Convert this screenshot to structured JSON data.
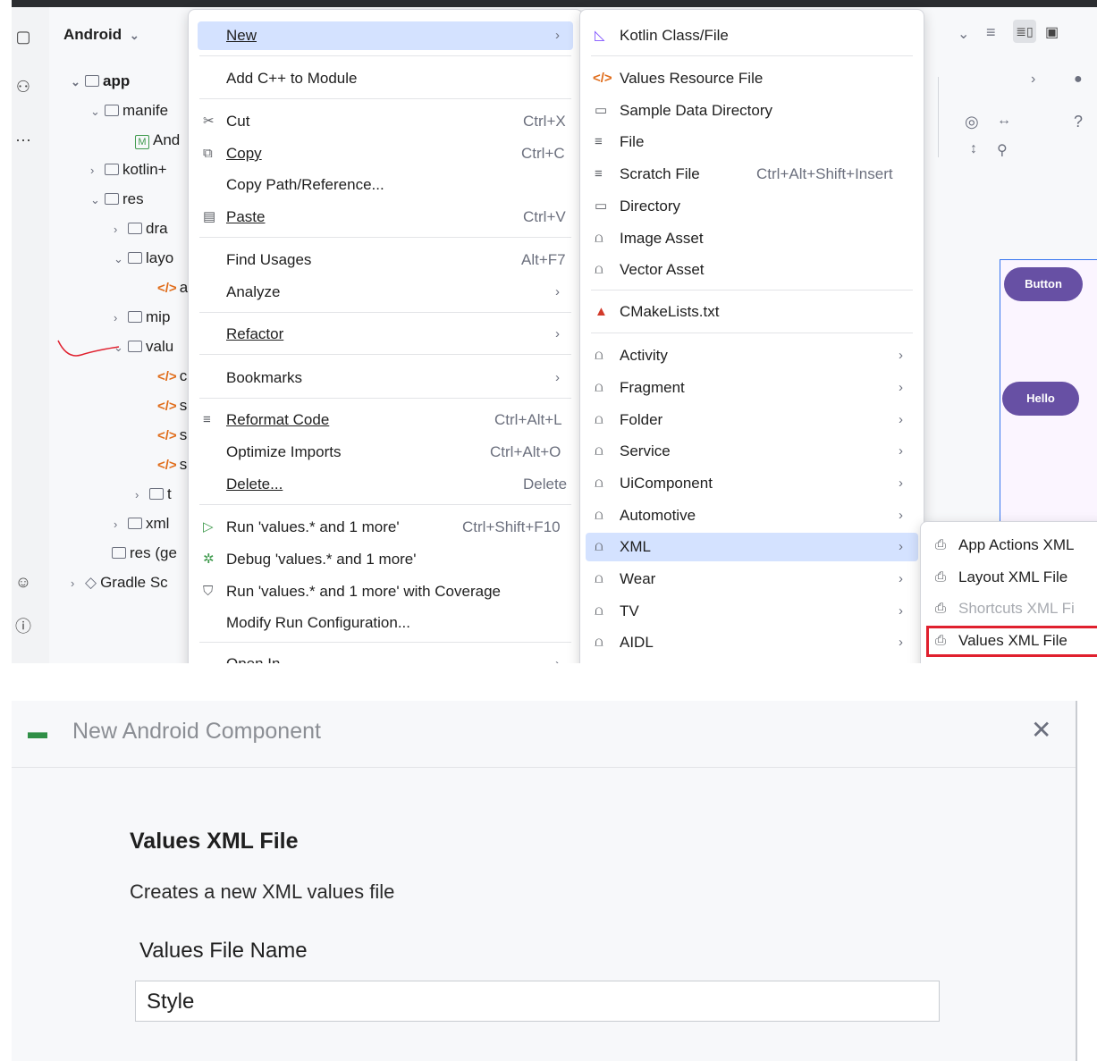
{
  "project": {
    "view_label": "Android",
    "tree": [
      {
        "label": "app",
        "bold": true
      },
      {
        "label": "manife"
      },
      {
        "label": "And"
      },
      {
        "label": "kotlin+"
      },
      {
        "label": "res"
      },
      {
        "label": "dra"
      },
      {
        "label": "layo"
      },
      {
        "label": "a"
      },
      {
        "label": "mip"
      },
      {
        "label": "valu"
      },
      {
        "label": "c"
      },
      {
        "label": "s"
      },
      {
        "label": "s"
      },
      {
        "label": "s"
      },
      {
        "label": "t"
      },
      {
        "label": "xml"
      },
      {
        "label": "res (ge"
      },
      {
        "label": "Gradle Sc"
      }
    ]
  },
  "preview": {
    "button1": "Button",
    "button2": "Hello"
  },
  "context_menu": {
    "items": [
      {
        "label": "New",
        "shortcut": ""
      },
      {
        "label": "Add C++ to Module",
        "shortcut": ""
      },
      {
        "label": "Cut",
        "shortcut": "Ctrl+X"
      },
      {
        "label": "Copy",
        "shortcut": "Ctrl+C"
      },
      {
        "label": "Copy Path/Reference...",
        "shortcut": ""
      },
      {
        "label": "Paste",
        "shortcut": "Ctrl+V"
      },
      {
        "label": "Find Usages",
        "shortcut": "Alt+F7"
      },
      {
        "label": "Analyze",
        "shortcut": ""
      },
      {
        "label": "Refactor",
        "shortcut": ""
      },
      {
        "label": "Bookmarks",
        "shortcut": ""
      },
      {
        "label": "Reformat Code",
        "shortcut": "Ctrl+Alt+L"
      },
      {
        "label": "Optimize Imports",
        "shortcut": "Ctrl+Alt+O"
      },
      {
        "label": "Delete...",
        "shortcut": "Delete"
      },
      {
        "label": "Run 'values.* and 1 more'",
        "shortcut": "Ctrl+Shift+F10"
      },
      {
        "label": "Debug 'values.* and 1 more'",
        "shortcut": ""
      },
      {
        "label": "Run 'values.* and 1 more' with Coverage",
        "shortcut": ""
      },
      {
        "label": "Modify Run Configuration...",
        "shortcut": ""
      },
      {
        "label": "Open In",
        "shortcut": ""
      }
    ]
  },
  "new_menu": {
    "items": [
      {
        "label": "Kotlin Class/File",
        "shortcut": ""
      },
      {
        "label": "Values Resource File",
        "shortcut": ""
      },
      {
        "label": "Sample Data Directory",
        "shortcut": ""
      },
      {
        "label": "File",
        "shortcut": ""
      },
      {
        "label": "Scratch File",
        "shortcut": "Ctrl+Alt+Shift+Insert"
      },
      {
        "label": "Directory",
        "shortcut": ""
      },
      {
        "label": "Image Asset",
        "shortcut": ""
      },
      {
        "label": "Vector Asset",
        "shortcut": ""
      },
      {
        "label": "CMakeLists.txt",
        "shortcut": ""
      },
      {
        "label": "Activity",
        "shortcut": ""
      },
      {
        "label": "Fragment",
        "shortcut": ""
      },
      {
        "label": "Folder",
        "shortcut": ""
      },
      {
        "label": "Service",
        "shortcut": ""
      },
      {
        "label": "UiComponent",
        "shortcut": ""
      },
      {
        "label": "Automotive",
        "shortcut": ""
      },
      {
        "label": "XML",
        "shortcut": ""
      },
      {
        "label": "Wear",
        "shortcut": ""
      },
      {
        "label": "TV",
        "shortcut": ""
      },
      {
        "label": "AIDL",
        "shortcut": ""
      }
    ]
  },
  "xml_menu": {
    "items": [
      {
        "label": "App Actions XML"
      },
      {
        "label": "Layout XML File"
      },
      {
        "label": "Shortcuts XML Fi"
      },
      {
        "label": "Values XML File"
      }
    ]
  },
  "dialog": {
    "title": "New Android Component",
    "heading": "Values XML File",
    "description": "Creates a new XML values file",
    "field_label": "Values File Name",
    "field_value": "Style"
  },
  "colors": {
    "selection": "#d4e2ff",
    "highlight_box": "#e0202e",
    "android_green": "#3ba55c",
    "preview_button": "#6750a4"
  }
}
